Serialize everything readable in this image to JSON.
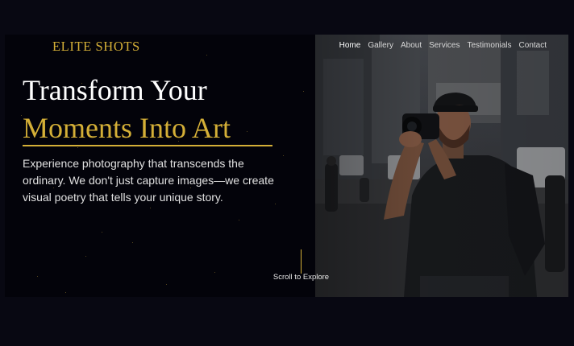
{
  "brand": {
    "logo": "ELITE SHOTS"
  },
  "nav": {
    "items": [
      {
        "label": "Home",
        "active": true
      },
      {
        "label": "Gallery",
        "active": false
      },
      {
        "label": "About",
        "active": false
      },
      {
        "label": "Services",
        "active": false
      },
      {
        "label": "Testimonials",
        "active": false
      },
      {
        "label": "Contact",
        "active": false
      }
    ]
  },
  "hero": {
    "title_line1": "Transform Your",
    "title_line2": "Moments Into Art",
    "description": "Experience photography that transcends the ordinary. We don't just capture images—we create visual poetry that tells your unique story.",
    "scroll_label": "Scroll to Explore"
  },
  "colors": {
    "accent": "#d4af37",
    "background": "#03030a",
    "text": "#ffffff"
  }
}
